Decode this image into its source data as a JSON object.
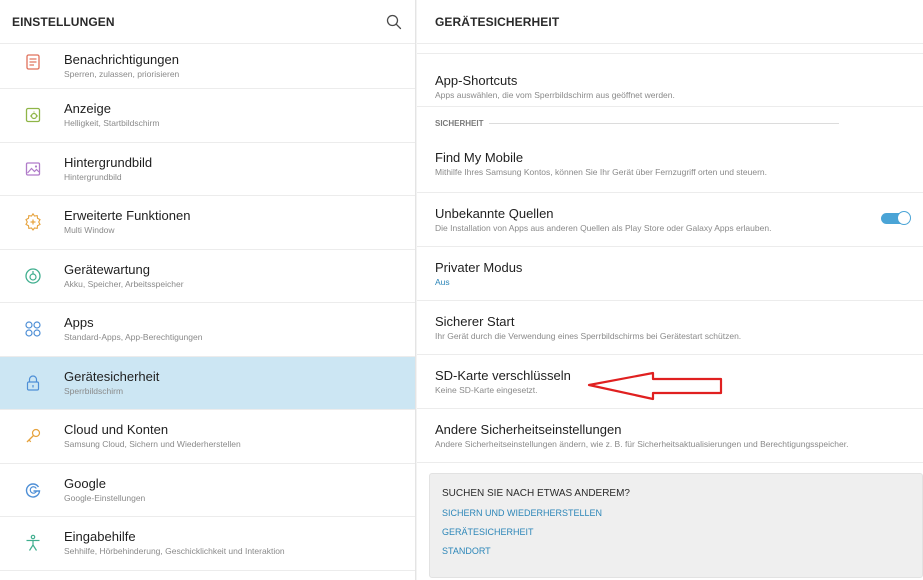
{
  "left_pane": {
    "title": "EINSTELLUNGEN",
    "items": [
      {
        "label": "Benachrichtigungen",
        "sub": "Sperren, zulassen, priorisieren",
        "icon": "notifications-icon"
      },
      {
        "label": "Anzeige",
        "sub": "Helligkeit, Startbildschirm",
        "icon": "display-icon"
      },
      {
        "label": "Hintergrundbild",
        "sub": "Hintergrundbild",
        "icon": "wallpaper-icon"
      },
      {
        "label": "Erweiterte Funktionen",
        "sub": "Multi Window",
        "icon": "advanced-features-icon"
      },
      {
        "label": "Gerätewartung",
        "sub": "Akku, Speicher, Arbeitsspeicher",
        "icon": "device-maintenance-icon"
      },
      {
        "label": "Apps",
        "sub": "Standard-Apps, App-Berechtigungen",
        "icon": "apps-icon"
      },
      {
        "label": "Gerätesicherheit",
        "sub": "Sperrbildschirm",
        "icon": "lock-icon",
        "active": true
      },
      {
        "label": "Cloud und Konten",
        "sub": "Samsung Cloud, Sichern und Wiederherstellen",
        "icon": "key-icon"
      },
      {
        "label": "Google",
        "sub": "Google-Einstellungen",
        "icon": "google-icon"
      },
      {
        "label": "Eingabehilfe",
        "sub": "Sehhilfe, Hörbehinderung, Geschicklichkeit und Interaktion",
        "icon": "accessibility-icon"
      }
    ]
  },
  "right_pane": {
    "title": "GERÄTESICHERHEIT",
    "app_shortcuts": {
      "label": "App-Shortcuts",
      "sub": "Apps auswählen, die vom Sperrbildschirm aus geöffnet werden."
    },
    "section_label": "SICHERHEIT",
    "find_my_mobile": {
      "label": "Find My Mobile",
      "sub": "Mithilfe Ihres Samsung Kontos, können Sie Ihr Gerät über Fernzugriff orten und steuern."
    },
    "unknown_sources": {
      "label": "Unbekannte Quellen",
      "sub": "Die Installation von Apps aus anderen Quellen als Play Store oder Galaxy Apps erlauben.",
      "toggle_on": true
    },
    "private_mode": {
      "label": "Privater Modus",
      "sub": "Aus"
    },
    "secure_start": {
      "label": "Sicherer Start",
      "sub": "Ihr Gerät durch die Verwendung eines Sperrbildschirms bei Gerätestart schützen."
    },
    "sd_encrypt": {
      "label": "SD-Karte verschlüsseln",
      "sub": "Keine SD-Karte eingesetzt."
    },
    "other_security": {
      "label": "Andere Sicherheitseinstellungen",
      "sub": "Andere Sicherheitseinstellungen ändern, wie z. B. für Sicherheitsaktualisierungen und Berechtigungsspeicher."
    },
    "suggest": {
      "heading": "SUCHEN SIE NACH ETWAS ANDEREM?",
      "links": [
        "SICHERN UND WIEDERHERSTELLEN",
        "GERÄTESICHERHEIT",
        "STANDORT"
      ]
    }
  },
  "colors": {
    "accent": "#2c86b8",
    "active_row": "#cce6f3",
    "toggle": "#4aa4d6",
    "annotation_arrow": "#e02020"
  }
}
